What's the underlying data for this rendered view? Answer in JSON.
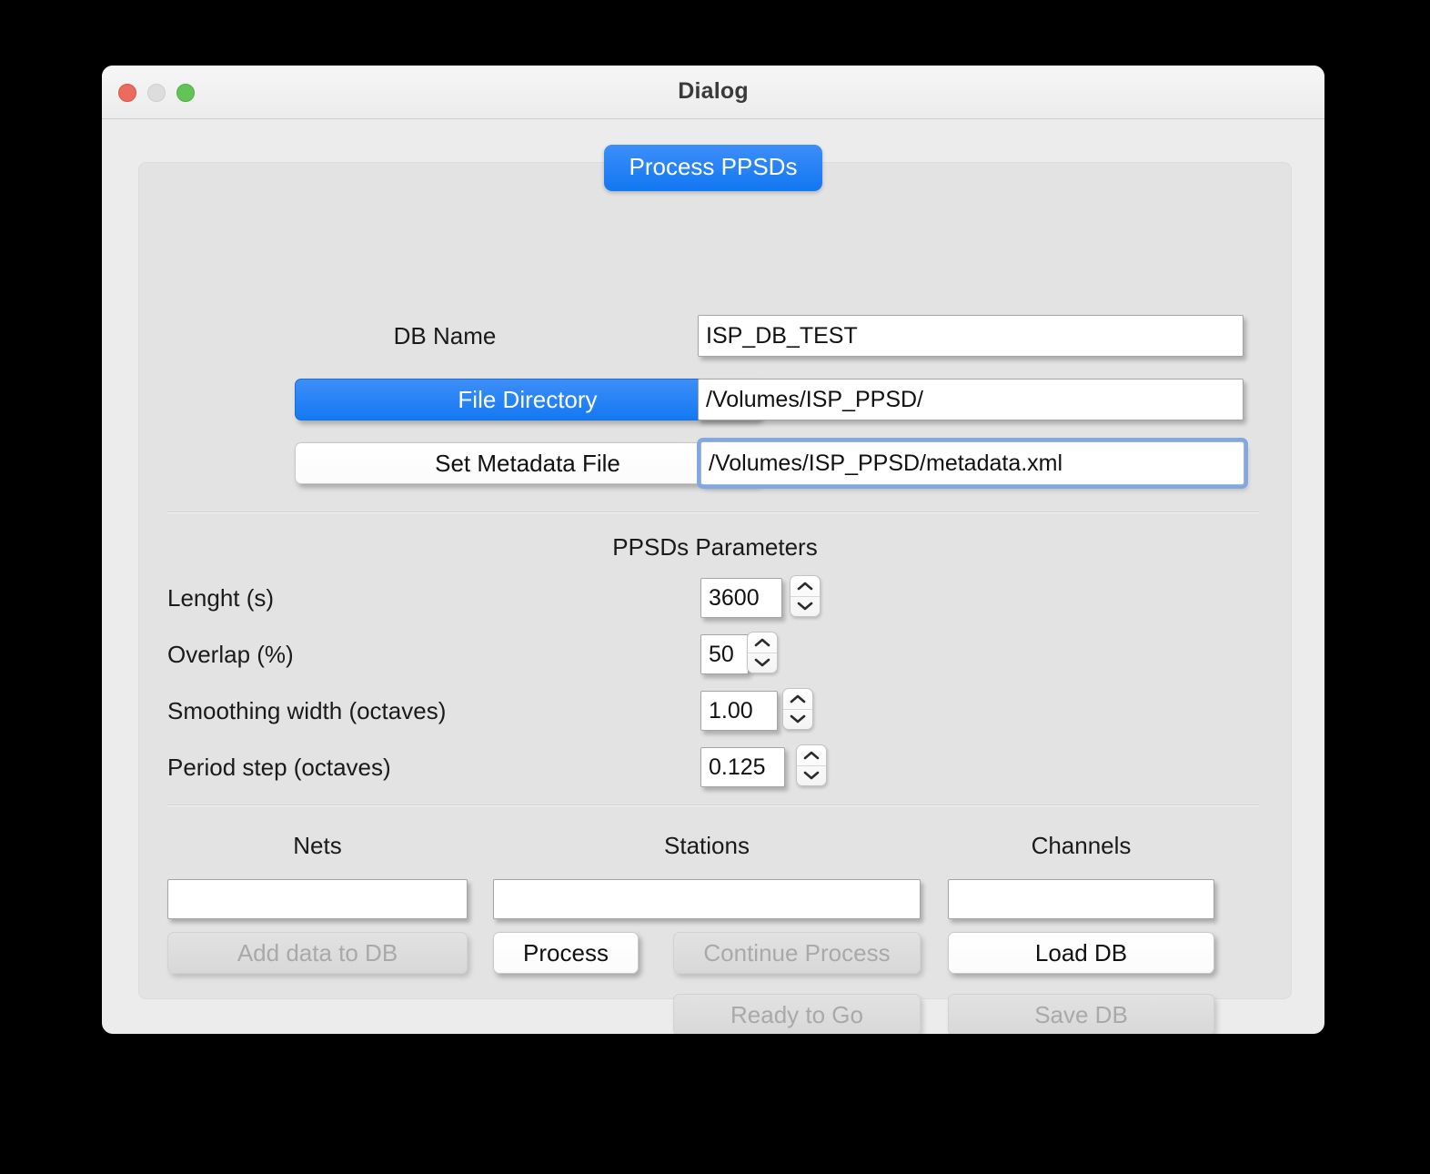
{
  "window": {
    "title": "Dialog",
    "traffic_lights": [
      "close-icon",
      "minimize-icon",
      "zoom-icon"
    ]
  },
  "tab": {
    "label": "Process PPSDs",
    "accent_color": "#1479f2"
  },
  "form": {
    "db_name_label": "DB Name",
    "db_name_value": "ISP_DB_TEST",
    "file_directory_button": "File Directory",
    "file_directory_value": "/Volumes/ISP_PPSD/",
    "set_metadata_button": "Set Metadata File",
    "set_metadata_value": "/Volumes/ISP_PPSD/metadata.xml"
  },
  "parameters": {
    "heading": "PPSDs Parameters",
    "rows": [
      {
        "label": "Lenght (s)",
        "value": "3600"
      },
      {
        "label": "Overlap (%)",
        "value": "50"
      },
      {
        "label": "Smoothing width (octaves)",
        "value": "1.00"
      },
      {
        "label": "Period step (octaves)",
        "value": "0.125"
      }
    ]
  },
  "filters": {
    "nets_label": "Nets",
    "nets_value": "",
    "stations_label": "Stations",
    "stations_value": "",
    "channels_label": "Channels",
    "channels_value": ""
  },
  "actions": {
    "add_data_to_db": "Add data to DB",
    "process": "Process",
    "continue_process": "Continue Process",
    "load_db": "Load DB",
    "ready_to_go": "Ready to Go",
    "save_db": "Save DB"
  }
}
